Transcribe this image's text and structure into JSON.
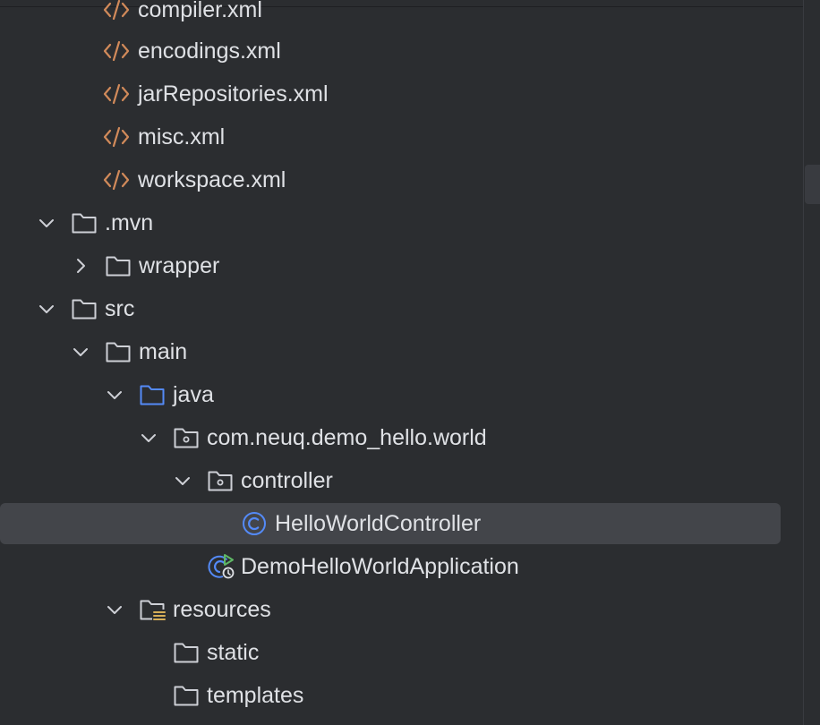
{
  "tree": {
    "items": [
      {
        "label": "compiler.xml",
        "icon": "xml-file-icon"
      },
      {
        "label": "encodings.xml",
        "icon": "xml-file-icon"
      },
      {
        "label": "jarRepositories.xml",
        "icon": "xml-file-icon"
      },
      {
        "label": "misc.xml",
        "icon": "xml-file-icon"
      },
      {
        "label": "workspace.xml",
        "icon": "xml-file-icon"
      },
      {
        "label": ".mvn",
        "icon": "folder-icon",
        "expanded": true
      },
      {
        "label": "wrapper",
        "icon": "folder-icon",
        "expanded": false
      },
      {
        "label": "src",
        "icon": "folder-icon",
        "expanded": true
      },
      {
        "label": "main",
        "icon": "folder-icon",
        "expanded": true
      },
      {
        "label": "java",
        "icon": "source-folder-icon",
        "expanded": true
      },
      {
        "label": "com.neuq.demo_hello.world",
        "icon": "package-icon",
        "expanded": true
      },
      {
        "label": "controller",
        "icon": "package-icon",
        "expanded": true
      },
      {
        "label": "HelloWorldController",
        "icon": "class-icon",
        "selected": true
      },
      {
        "label": "DemoHelloWorldApplication",
        "icon": "spring-boot-app-icon"
      },
      {
        "label": "resources",
        "icon": "resources-folder-icon",
        "expanded": true
      },
      {
        "label": "static",
        "icon": "folder-icon"
      },
      {
        "label": "templates",
        "icon": "folder-icon"
      }
    ]
  },
  "colors": {
    "background": "#2b2d30",
    "selection": "#43454a",
    "text": "#dfe1e5",
    "xml_icon": "#d18a5a",
    "folder_icon": "#ced0d6",
    "source_folder_icon": "#548af7",
    "class_icon": "#548af7",
    "run_marker": "#5fb865",
    "resources_marker": "#d6ae58"
  }
}
